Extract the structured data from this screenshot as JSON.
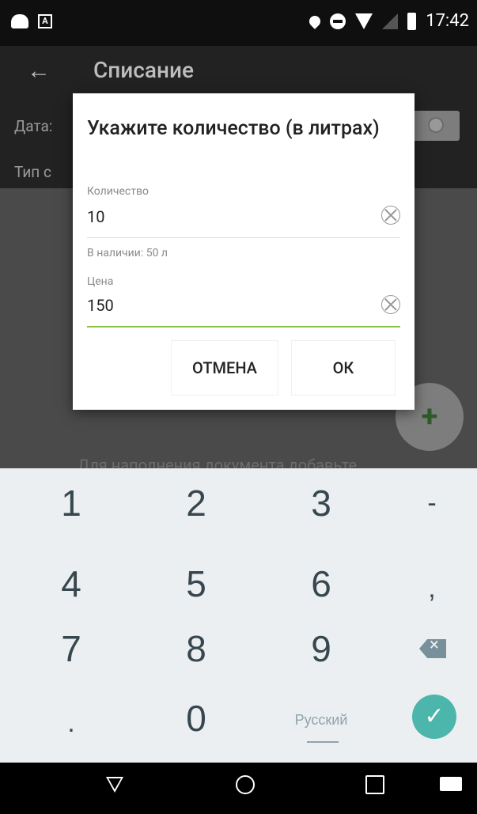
{
  "status_bar": {
    "time": "17:42"
  },
  "app_bar": {
    "title": "Списание",
    "date_label": "Дата:",
    "type_label": "Тип с"
  },
  "content": {
    "hint": "Для наполнения документа добавьте"
  },
  "dialog": {
    "title": "Укажите количество (в литрах)",
    "quantity_label": "Количество",
    "quantity_value": "10",
    "available": "В наличии: 50 л",
    "price_label": "Цена",
    "price_value": "150",
    "cancel": "ОТМЕНА",
    "ok": "ОК"
  },
  "keyboard": {
    "rows": [
      [
        "1",
        "2",
        "3",
        "-"
      ],
      [
        "4",
        "5",
        "6",
        ","
      ],
      [
        "7",
        "8",
        "9"
      ],
      [
        ".",
        "0",
        "Русский"
      ]
    ]
  },
  "colors": {
    "accent": "#8bc34a",
    "enter_key": "#4db6ac"
  }
}
